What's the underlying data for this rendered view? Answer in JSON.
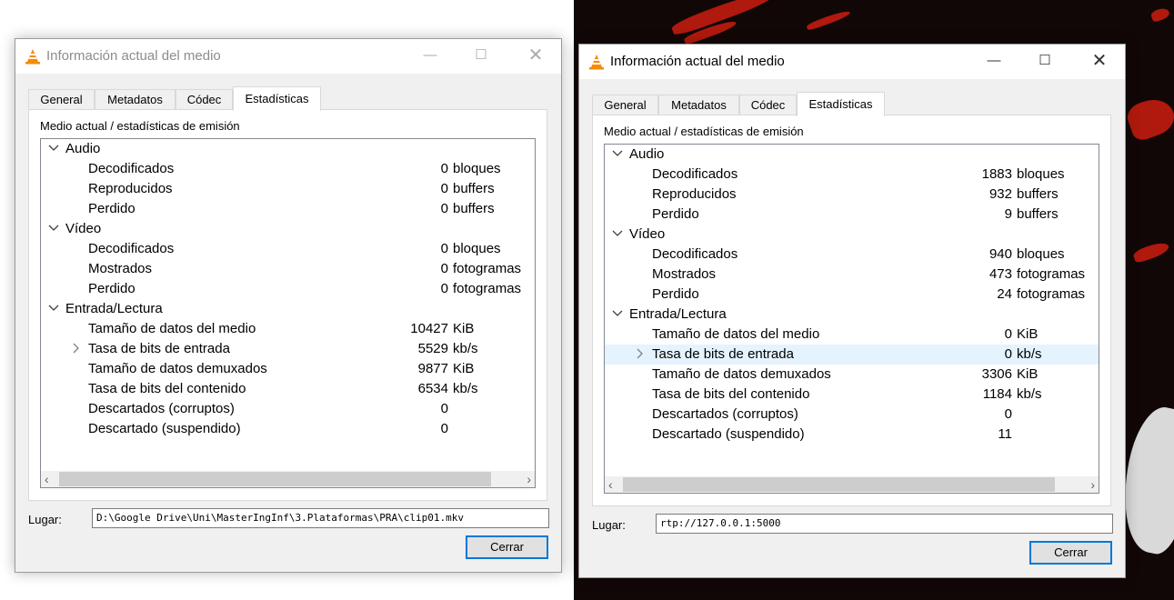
{
  "windows": [
    {
      "state": "inactive",
      "title": "Información actual del medio",
      "tabs": [
        {
          "label": "General"
        },
        {
          "label": "Metadatos"
        },
        {
          "label": "Códec"
        },
        {
          "label": "Estadísticas"
        }
      ],
      "active_tab": "Estadísticas",
      "panel_title": "Medio actual / estadísticas de emisión",
      "groups": [
        {
          "name": "Audio",
          "rows": [
            {
              "label": "Decodificados",
              "value": "0",
              "unit": "bloques"
            },
            {
              "label": "Reproducidos",
              "value": "0",
              "unit": "buffers"
            },
            {
              "label": "Perdido",
              "value": "0",
              "unit": "buffers"
            }
          ]
        },
        {
          "name": "Vídeo",
          "rows": [
            {
              "label": "Decodificados",
              "value": "0",
              "unit": "bloques"
            },
            {
              "label": "Mostrados",
              "value": "0",
              "unit": "fotogramas"
            },
            {
              "label": "Perdido",
              "value": "0",
              "unit": "fotogramas"
            }
          ]
        },
        {
          "name": "Entrada/Lectura",
          "rows": [
            {
              "label": "Tamaño de datos del medio",
              "value": "10427",
              "unit": "KiB"
            },
            {
              "label": "Tasa de bits de entrada",
              "value": "5529",
              "unit": "kb/s"
            },
            {
              "label": "Tamaño de datos demuxados",
              "value": "9877",
              "unit": "KiB"
            },
            {
              "label": "Tasa de bits del contenido",
              "value": "6534",
              "unit": "kb/s"
            },
            {
              "label": "Descartados (corruptos)",
              "value": "0",
              "unit": ""
            },
            {
              "label": "Descartado (suspendido)",
              "value": "0",
              "unit": ""
            }
          ]
        }
      ],
      "location_label": "Lugar:",
      "location_value": "D:\\Google Drive\\Uni\\MasterIngInf\\3.Plataformas\\PRA\\clip01.mkv",
      "close_button": "Cerrar"
    },
    {
      "state": "active",
      "title": "Información actual del medio",
      "tabs": [
        {
          "label": "General"
        },
        {
          "label": "Metadatos"
        },
        {
          "label": "Códec"
        },
        {
          "label": "Estadísticas"
        }
      ],
      "active_tab": "Estadísticas",
      "panel_title": "Medio actual / estadísticas de emisión",
      "groups": [
        {
          "name": "Audio",
          "rows": [
            {
              "label": "Decodificados",
              "value": "1883",
              "unit": "bloques"
            },
            {
              "label": "Reproducidos",
              "value": "932",
              "unit": "buffers"
            },
            {
              "label": "Perdido",
              "value": "9",
              "unit": "buffers"
            }
          ]
        },
        {
          "name": "Vídeo",
          "rows": [
            {
              "label": "Decodificados",
              "value": "940",
              "unit": "bloques"
            },
            {
              "label": "Mostrados",
              "value": "473",
              "unit": "fotogramas"
            },
            {
              "label": "Perdido",
              "value": "24",
              "unit": "fotogramas"
            }
          ]
        },
        {
          "name": "Entrada/Lectura",
          "rows": [
            {
              "label": "Tamaño de datos del medio",
              "value": "0",
              "unit": "KiB"
            },
            {
              "label": "Tasa de bits de entrada",
              "value": "0",
              "unit": "kb/s"
            },
            {
              "label": "Tamaño de datos demuxados",
              "value": "3306",
              "unit": "KiB"
            },
            {
              "label": "Tasa de bits del contenido",
              "value": "1184",
              "unit": "kb/s"
            },
            {
              "label": "Descartados (corruptos)",
              "value": "0",
              "unit": ""
            },
            {
              "label": "Descartado (suspendido)",
              "value": "11",
              "unit": ""
            }
          ]
        }
      ],
      "location_label": "Lugar:",
      "location_value": "rtp://127.0.0.1:5000",
      "close_button": "Cerrar"
    }
  ],
  "colors": {
    "accent": "#0078d7",
    "row_highlight": "#e5f3ff",
    "video_background": "#120707",
    "video_splash": "#b0190d"
  }
}
